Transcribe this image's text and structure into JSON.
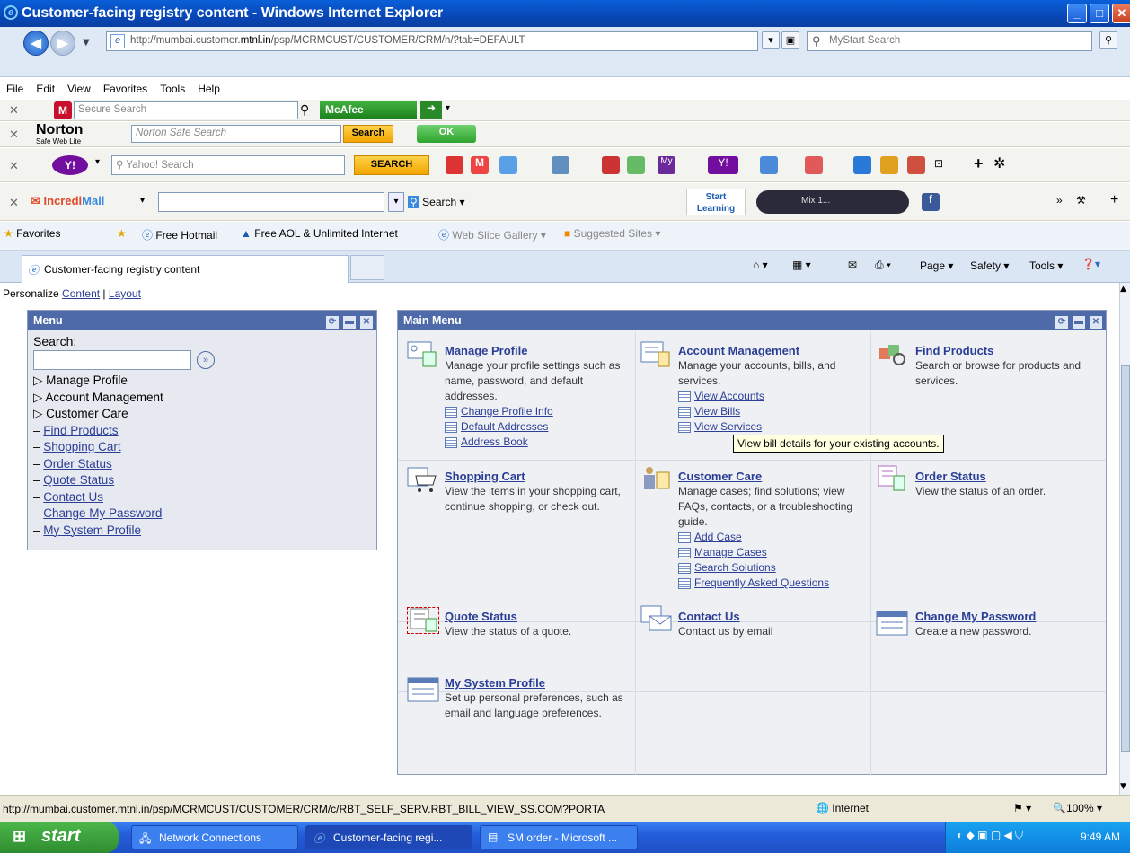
{
  "window": {
    "title": "Customer-facing registry content - Windows Internet Explorer"
  },
  "address": {
    "url_prefix": "http://mumbai.customer.",
    "url_host": "mtnl.in",
    "url_rest": "/psp/MCRMCUST/CUSTOMER/CRM/h/?tab=DEFAULT",
    "search_placeholder": "MyStart Search"
  },
  "menubar": [
    "File",
    "Edit",
    "View",
    "Favorites",
    "Tools",
    "Help"
  ],
  "toolbars": {
    "mcafee": {
      "search_placeholder": "Secure Search",
      "brand": "McAfee"
    },
    "norton": {
      "brand": "Norton",
      "sub": "Safe Web Lite",
      "search_placeholder": "Norton Safe Search",
      "search_btn": "Search",
      "ok": "OK"
    },
    "yahoo": {
      "search_placeholder": "Yahoo! Search",
      "search_btn": "SEARCH"
    },
    "incredimail": {
      "brand_a": "Incredi",
      "brand_b": "Mail",
      "search_label": "Search",
      "start_learning": "Start Learning",
      "player": "Mix 1..."
    }
  },
  "favorites": {
    "label": "Favorites",
    "items": [
      "Free Hotmail",
      "Free AOL & Unlimited Internet",
      "Web Slice Gallery",
      "Suggested Sites"
    ]
  },
  "tab": {
    "label": "Customer-facing registry content",
    "cmd": [
      "Page",
      "Safety",
      "Tools"
    ]
  },
  "personalize": {
    "label": "Personalize",
    "content": "Content",
    "sep": "|",
    "layout": "Layout"
  },
  "menu_pagelet": {
    "title": "Menu",
    "search_label": "Search:",
    "folders": [
      "Manage Profile",
      "Account Management",
      "Customer Care"
    ],
    "links": [
      "Find Products",
      "Shopping Cart",
      "Order Status",
      "Quote Status",
      "Contact Us",
      "Change My Password",
      "My System Profile"
    ]
  },
  "main_menu": {
    "title": "Main Menu",
    "manage_profile": {
      "title": "Manage Profile",
      "desc": "Manage your profile settings such as name, password, and default addresses.",
      "links": [
        "Change Profile Info",
        "Default Addresses",
        "Address Book"
      ]
    },
    "account_management": {
      "title": "Account Management",
      "desc": "Manage your accounts, bills, and services.",
      "links": [
        "View Accounts",
        "View Bills",
        "View Services"
      ]
    },
    "find_products": {
      "title": "Find Products",
      "desc": "Search or browse for products and services."
    },
    "shopping_cart": {
      "title": "Shopping Cart",
      "desc": "View the items in your shopping cart, continue shopping, or check out."
    },
    "customer_care": {
      "title": "Customer Care",
      "desc": "Manage cases; find solutions; view FAQs, contacts, or a troubleshooting guide.",
      "links": [
        "Add Case",
        "Manage Cases",
        "Search Solutions",
        "Frequently Asked Questions"
      ]
    },
    "order_status": {
      "title": "Order Status",
      "desc": "View the status of an order."
    },
    "quote_status": {
      "title": "Quote Status",
      "desc": "View the status of a quote."
    },
    "contact_us": {
      "title": "Contact Us",
      "desc": "Contact us by email"
    },
    "change_password": {
      "title": "Change My Password",
      "desc": "Create a new password."
    },
    "system_profile": {
      "title": "My System Profile",
      "desc": "Set up personal preferences, such as email and language preferences."
    }
  },
  "tooltip": "View bill details for your existing accounts.",
  "status": {
    "url": "http://mumbai.customer.mtnl.in/psp/MCRMCUST/CUSTOMER/CRM/c/RBT_SELF_SERV.RBT_BILL_VIEW_SS.COM?PORTA",
    "zone": "Internet",
    "zoom": "100%"
  },
  "taskbar": {
    "start": "start",
    "tasks": [
      "Network Connections",
      "Customer-facing regi...",
      "SM order - Microsoft ..."
    ],
    "clock": "9:49 AM"
  }
}
